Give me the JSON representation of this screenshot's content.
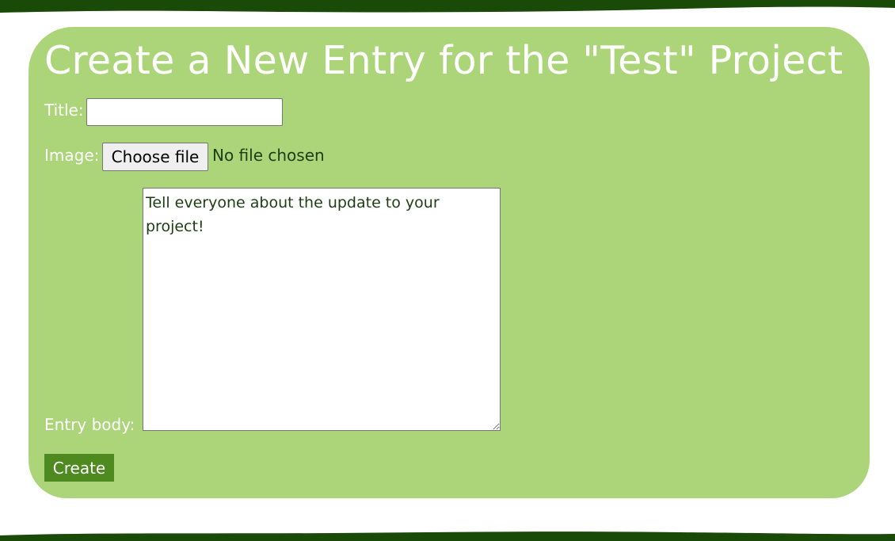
{
  "theme": {
    "wave_color": "#1a4a07",
    "card_color": "#abd578",
    "button_color": "#4e8a1f",
    "text_color": "#ffffff",
    "dark_text_color": "#1e3d14"
  },
  "form": {
    "heading": "Create a New Entry for the \"Test\" Project",
    "title_label": "Title:",
    "title_value": "",
    "image_label": "Image:",
    "file_button_label": "Choose file",
    "file_status": "No file chosen",
    "body_label": "Entry body:",
    "body_placeholder": "Tell everyone about the update to your project!",
    "submit_label": "Create"
  }
}
